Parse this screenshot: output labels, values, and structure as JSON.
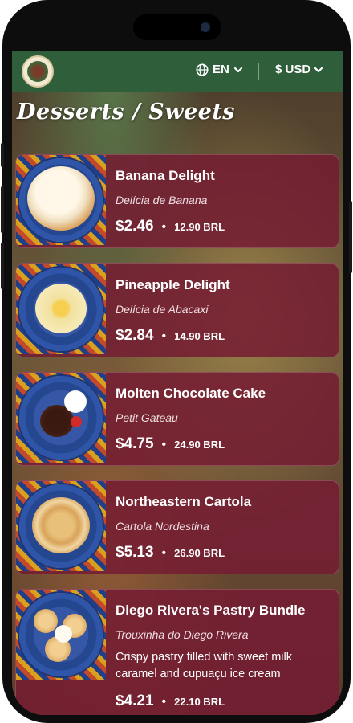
{
  "header": {
    "language": "EN",
    "currency": "$ USD"
  },
  "page_title": "Desserts / Sweets",
  "items": [
    {
      "name": "Banana Delight",
      "subtitle": "Delícia de Banana",
      "price": "$2.46",
      "price_brl": "12.90 BRL"
    },
    {
      "name": "Pineapple Delight",
      "subtitle": "Delícia de Abacaxi",
      "price": "$2.84",
      "price_brl": "14.90 BRL"
    },
    {
      "name": "Molten Chocolate Cake",
      "subtitle": "Petit Gateau",
      "price": "$4.75",
      "price_brl": "24.90 BRL"
    },
    {
      "name": "Northeastern Cartola",
      "subtitle": "Cartola Nordestina",
      "price": "$5.13",
      "price_brl": "26.90 BRL"
    },
    {
      "name": "Diego Rivera's Pastry Bundle",
      "subtitle": "Trouxinha do Diego Rivera",
      "description": "Crispy pastry filled with sweet milk caramel and cupuaçu ice cream",
      "price": "$4.21",
      "price_brl": "22.10 BRL"
    }
  ],
  "separator": "•"
}
